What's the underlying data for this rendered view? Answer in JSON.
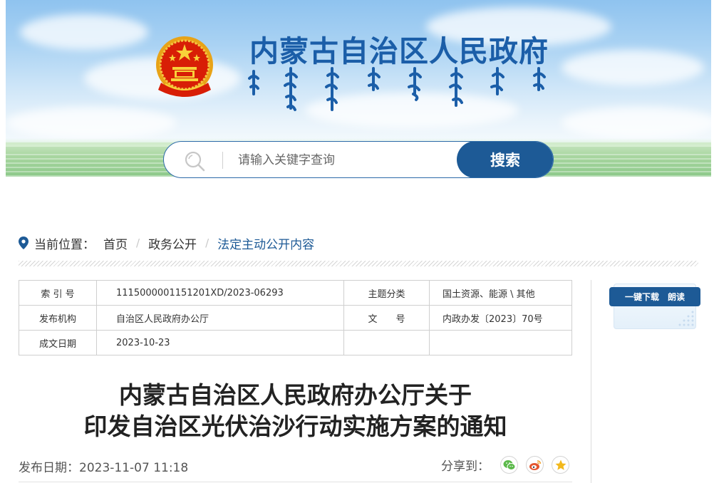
{
  "site": {
    "title": "内蒙古自治区人民政府",
    "mongolian_subtitle": "ᠥᠪᠥᠷ ᠮᠣᠩᠭᠣᠯ ᠤᠨ ᠥᠪᠡᠷᠲᠡᠭᠡᠨ ᠵᠠᠰᠠᠬᠤ ᠣᠷᠣᠨ ᠤ ᠠᠷᠠᠳ ᠤᠨ ᠵᠠᠰᠠᠭ ᠤᠨ ᠭᠠᠵᠠᠷ",
    "emblem_icon": "national-emblem-icon"
  },
  "search": {
    "placeholder": "请输入关键字查询",
    "button_label": "搜索",
    "icon": "search-icon"
  },
  "breadcrumb": {
    "label": "当前位置：",
    "items": [
      "首页",
      "政务公开",
      "法定主动公开内容"
    ],
    "separator": "/"
  },
  "info": {
    "rows": [
      {
        "k1": "索 引 号",
        "v1": "1115000001151201XD/2023-06293",
        "k2": "主题分类",
        "v2": "国土资源、能源 \\ 其他"
      },
      {
        "k1": "发布机构",
        "v1": "自治区人民政府办公厅",
        "k2": "文　　号",
        "v2": "内政办发〔2023〕70号"
      },
      {
        "k1": "成文日期",
        "v1": "2023-10-23",
        "k2": "",
        "v2": ""
      }
    ]
  },
  "widget": {
    "download_label": "一键下载",
    "read_label": "朗读"
  },
  "document": {
    "title_line1": "内蒙古自治区人民政府办公厅关于",
    "title_line2": "印发自治区光伏治沙行动实施方案的通知",
    "pub_label": "发布日期：",
    "pub_date": "2023-11-07 11:18",
    "share_label": "分享到：",
    "share_targets": [
      "wechat-icon",
      "weibo-icon",
      "favorite-star-icon"
    ]
  },
  "colors": {
    "brand_blue": "#1d5a96",
    "title_blue": "#1b5ea8",
    "wechat_green": "#5bb94a",
    "weibo_red": "#e4572e",
    "star_gold": "#f2b81c"
  }
}
